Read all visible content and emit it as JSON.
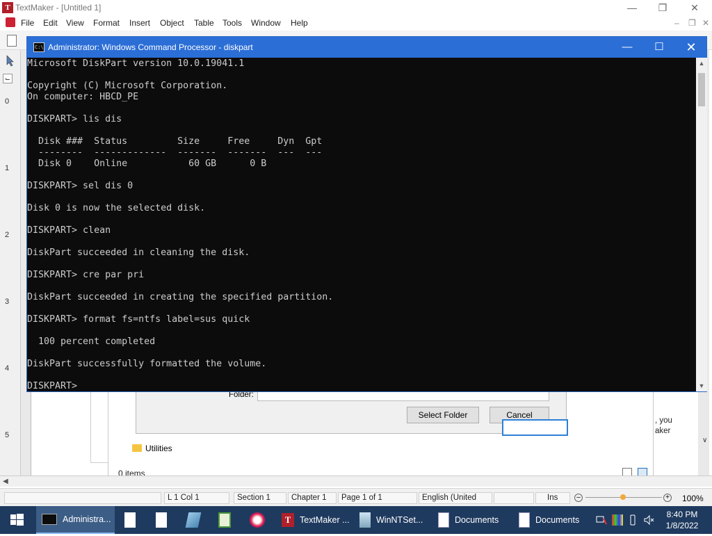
{
  "textmaker": {
    "title": "TextMaker - [Untitled 1]",
    "app_icon_letter": "T",
    "menu": [
      "File",
      "Edit",
      "View",
      "Format",
      "Insert",
      "Object",
      "Table",
      "Tools",
      "Window",
      "Help"
    ],
    "ruler_numbers": [
      "0",
      "1",
      "2",
      "3",
      "4",
      "5"
    ],
    "status": {
      "position": "L 1 Col 1",
      "section": "Section 1",
      "chapter": "Chapter 1",
      "page": "Page 1 of 1",
      "language": "English (United",
      "mode": "Ins",
      "zoom": "100%"
    },
    "page_text_lines": [
      ", you",
      "aker"
    ]
  },
  "folder_dialog": {
    "folder_label": "Folder:",
    "folder_value": "",
    "select_button": "Select Folder",
    "cancel_button": "Cancel",
    "list_item": "Utilities",
    "items_count": "0 items"
  },
  "cmd": {
    "title": "Administrator: Windows Command Processor - diskpart",
    "icon_text": "C:\\",
    "output": "Microsoft DiskPart version 10.0.19041.1\n\nCopyright (C) Microsoft Corporation.\nOn computer: HBCD_PE\n\nDISKPART> lis dis\n\n  Disk ###  Status         Size     Free     Dyn  Gpt\n  --------  -------------  -------  -------  ---  ---\n  Disk 0    Online           60 GB      0 B\n\nDISKPART> sel dis 0\n\nDisk 0 is now the selected disk.\n\nDISKPART> clean\n\nDiskPart succeeded in cleaning the disk.\n\nDISKPART> cre par pri\n\nDiskPart succeeded in creating the specified partition.\n\nDISKPART> format fs=ntfs label=sus quick\n\n  100 percent completed\n\nDiskPart successfully formatted the volume.\n\nDISKPART> "
  },
  "taskbar": {
    "items": [
      {
        "label": "Administra...",
        "icon": "cmd-icon",
        "active": true
      },
      {
        "label": "",
        "icon": "document-icon"
      },
      {
        "label": "",
        "icon": "document-icon"
      },
      {
        "label": "",
        "icon": "disk-icon"
      },
      {
        "label": "",
        "icon": "spreadsheet-icon"
      },
      {
        "label": "",
        "icon": "brush-icon"
      },
      {
        "label": "TextMaker ...",
        "icon": "textmaker-icon"
      },
      {
        "label": "WinNTSet...",
        "icon": "setup-icon"
      },
      {
        "label": "Documents",
        "icon": "document-icon"
      },
      {
        "label": "Documents",
        "icon": "document-icon"
      }
    ],
    "time": "8:40 PM",
    "date": "1/8/2022"
  }
}
